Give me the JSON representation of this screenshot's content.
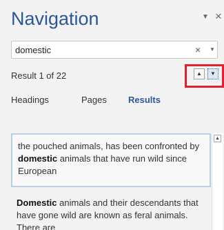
{
  "pane": {
    "title": "Navigation",
    "menu_icon": "▼",
    "close_icon": "×"
  },
  "search": {
    "value": "domestic",
    "clear_icon": "×",
    "dropdown_icon": "▼"
  },
  "results_nav": {
    "count_text": "Result 1 of 22",
    "prev_icon": "▲",
    "next_icon": "▼"
  },
  "tabs": [
    {
      "label": "Headings"
    },
    {
      "label": "Pages"
    },
    {
      "label": "Results"
    }
  ],
  "results": [
    {
      "before": "the pouched animals, has been confronted by ",
      "match": "domestic",
      "after": " animals that have run wild since European"
    },
    {
      "before": "",
      "match": "Domestic",
      "after": " animals and their descendants that have gone wild are known as feral animals. There are"
    }
  ],
  "scrollbar": {
    "up_icon": "▲"
  },
  "colors": {
    "title": "#2b579a",
    "highlight_box": "#e0202a",
    "active_tab": "#2b579a"
  }
}
